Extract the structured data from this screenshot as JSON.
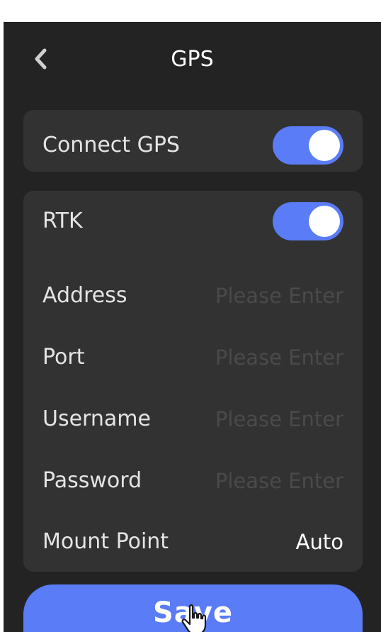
{
  "header": {
    "title": "GPS",
    "back_icon": "chevron-left-icon"
  },
  "gps_card": {
    "label": "Connect GPS",
    "enabled": true
  },
  "rtk_card": {
    "label": "RTK",
    "enabled": true,
    "fields": [
      {
        "label": "Address",
        "placeholder": "Please Enter",
        "value": ""
      },
      {
        "label": "Port",
        "placeholder": "Please Enter",
        "value": ""
      },
      {
        "label": "Username",
        "placeholder": "Please Enter",
        "value": ""
      },
      {
        "label": "Password",
        "placeholder": "Please Enter",
        "value": ""
      }
    ],
    "mount_point": {
      "label": "Mount Point",
      "value": "Auto"
    }
  },
  "save": {
    "label": "Save"
  },
  "colors": {
    "background": "#232323",
    "card": "#323232",
    "accent": "#5b7cf7",
    "placeholder": "#4a4a4a",
    "text": "#e4e4e4"
  },
  "icons": {
    "cursor": "hand-pointer-icon"
  }
}
